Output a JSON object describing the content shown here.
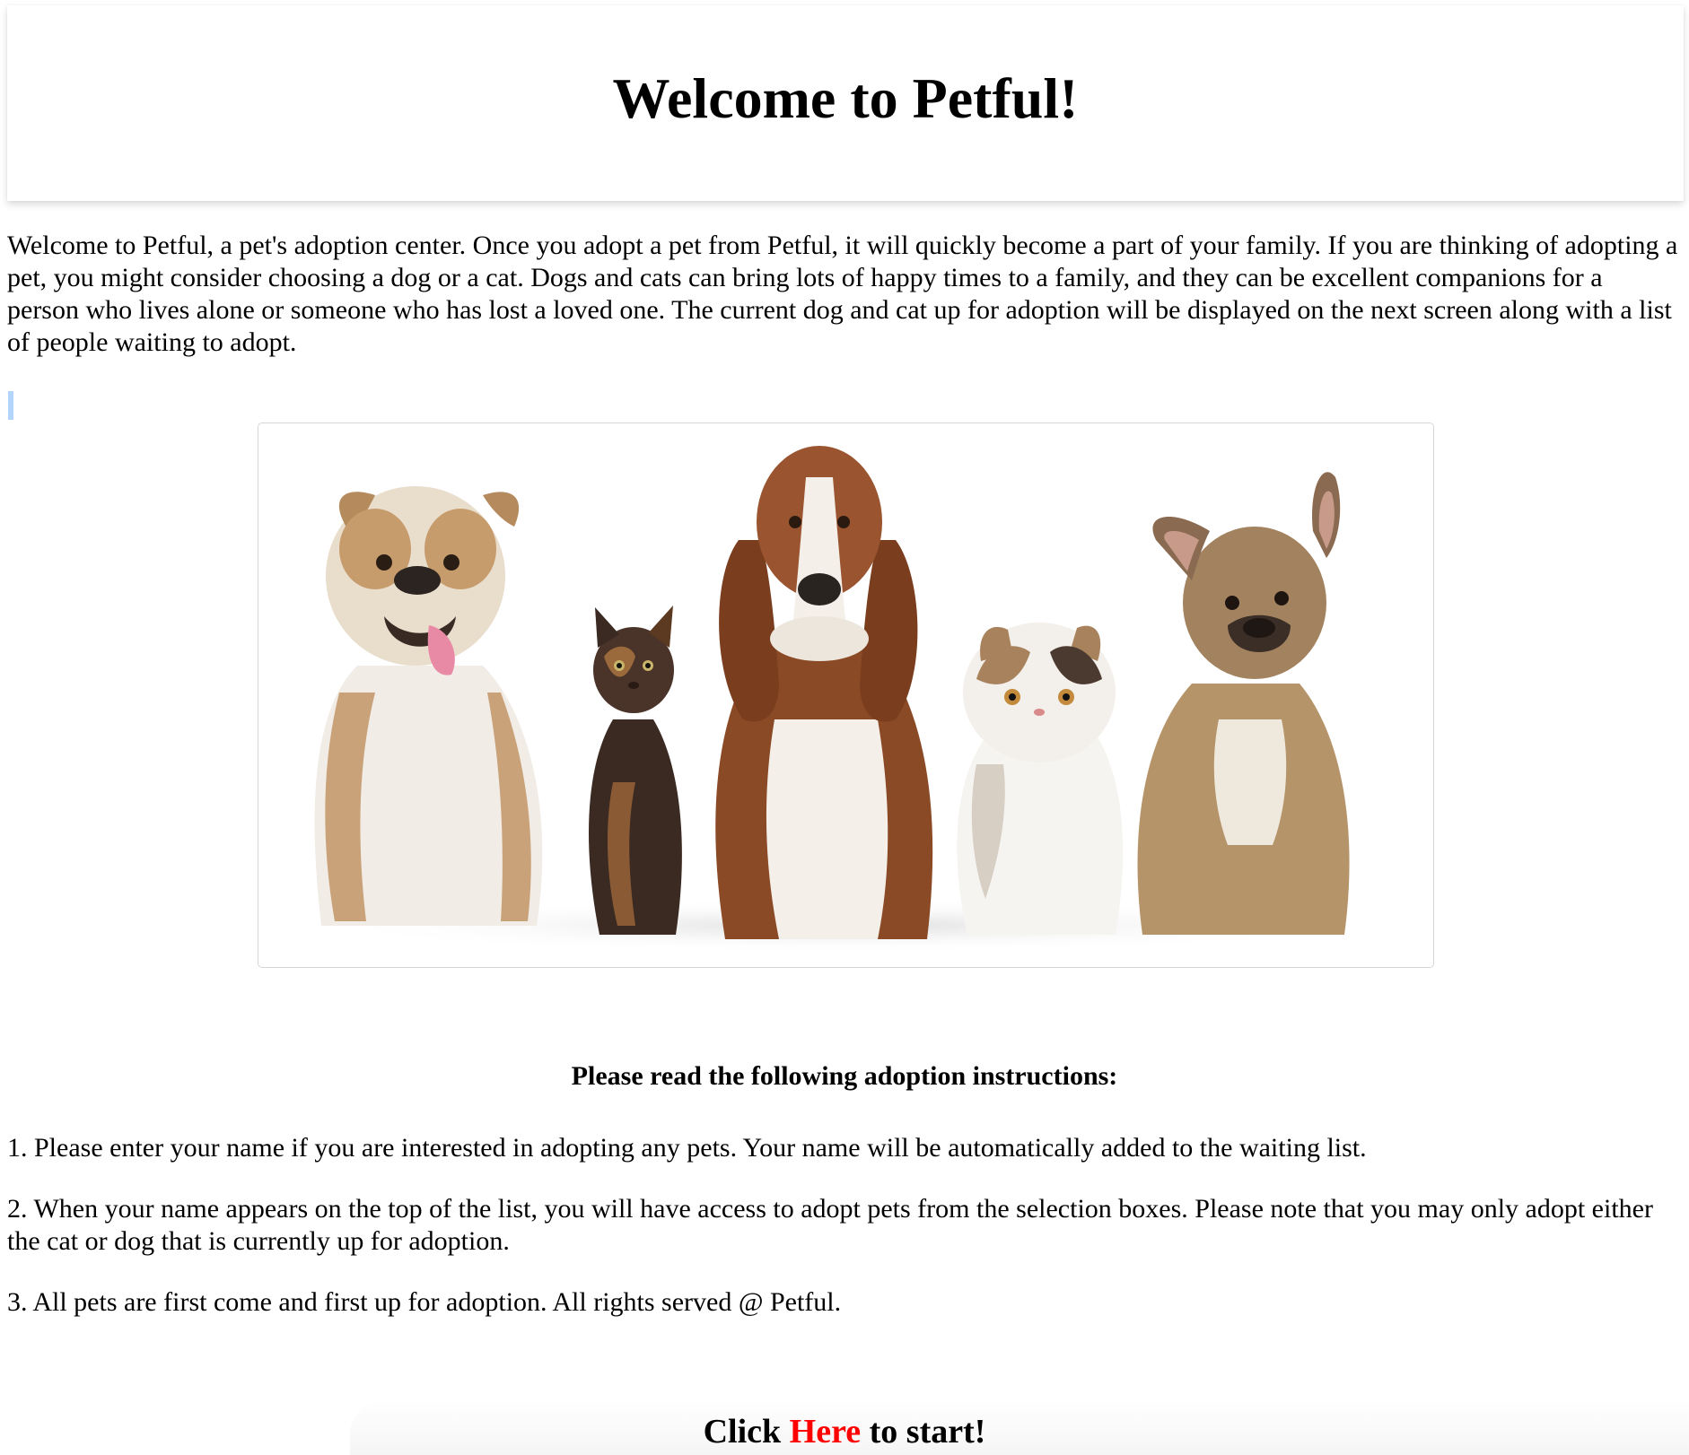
{
  "header": {
    "title": "Welcome to Petful!"
  },
  "intro": {
    "text": "Welcome to Petful, a pet's adoption center. Once you adopt a pet from Petful, it will quickly become a part of your family. If you are thinking of adopting a pet, you might consider choosing a dog or a cat. Dogs and cats can bring lots of happy times to a family, and they can be excellent companions for a person who lives alone or someone who has lost a loved one. The current dog and cat up for adoption will be displayed on the next screen along with a list of people waiting to adopt."
  },
  "hero_image": {
    "subjects": [
      "bulldog",
      "tortoiseshell-kitten",
      "basset-hound",
      "exotic-shorthair-cat",
      "french-bulldog"
    ]
  },
  "instructions": {
    "title": "Please read the following adoption instructions:",
    "steps": [
      "1. Please enter your name if you are interested in adopting any pets. Your name will be automatically added to the waiting list.",
      "2. When your name appears on the top of the list, you will have access to adopt pets from the selection boxes. Please note that you may only adopt either the cat or dog that is currently up for adoption.",
      "3. All pets are first come and first up for adoption. All rights served @ Petful."
    ]
  },
  "start": {
    "prefix": "Click ",
    "link_label": "Here",
    "suffix": " to start!"
  },
  "colors": {
    "link": "#ff0000",
    "image_border": "#d6d6d6",
    "selection_mark": "#b3d4fc"
  }
}
